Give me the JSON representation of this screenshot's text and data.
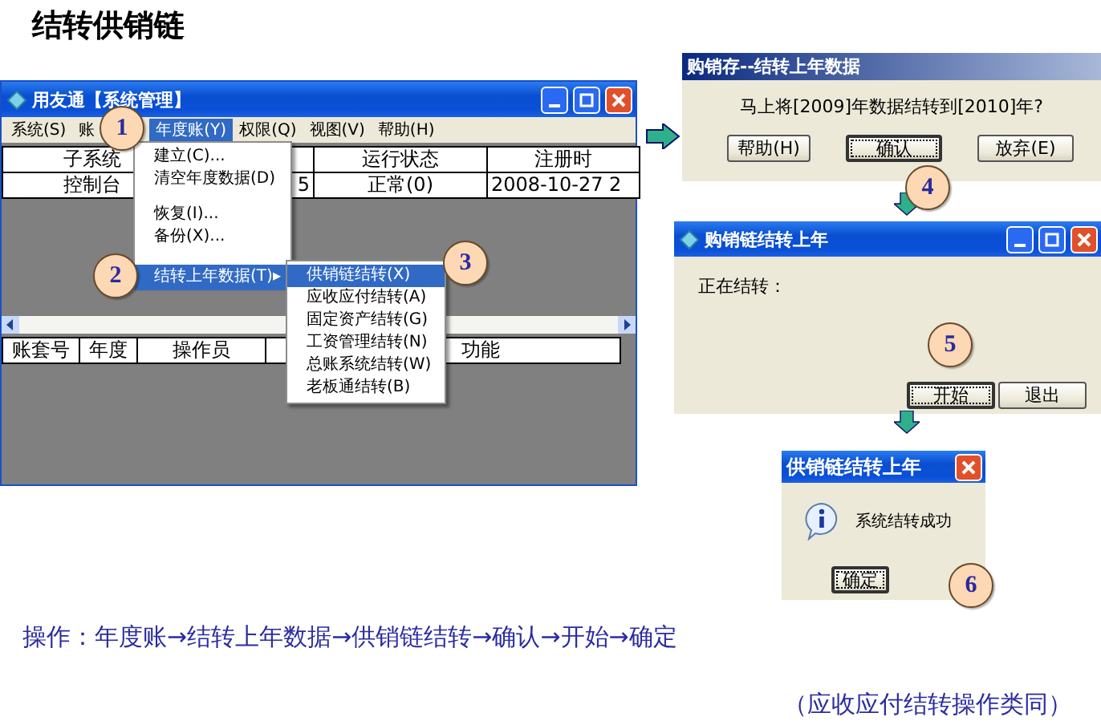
{
  "slide_title": "结转供销链",
  "main_window": {
    "title": "用友通【系统管理】",
    "menubar": [
      {
        "label": "系统(S)",
        "selected": false
      },
      {
        "label": "账",
        "selected": false
      },
      {
        "label": "年度账(Y)",
        "selected": true
      },
      {
        "label": "权限(Q)",
        "selected": false
      },
      {
        "label": "视图(V)",
        "selected": false
      },
      {
        "label": "帮助(H)",
        "selected": false
      }
    ],
    "table_1": {
      "columns": [
        {
          "header": "子系统"
        },
        {},
        {
          "header": "运行状态"
        },
        {
          "header": "注册时"
        }
      ],
      "rows": [
        [
          "控制台",
          "5",
          "正常(0)",
          "2008-10-27 2"
        ]
      ]
    },
    "table_2": {
      "columns": [
        {
          "header": "账套号"
        },
        {
          "header": "年度"
        },
        {
          "header": "操作员"
        },
        {},
        {
          "header": "功能"
        }
      ]
    }
  },
  "year_menu": [
    {
      "kind": "item",
      "label": "建立(C)...",
      "selected": false
    },
    {
      "kind": "item",
      "label": "清空年度数据(D)",
      "selected": false
    },
    {
      "kind": "separator"
    },
    {
      "kind": "item",
      "label": "恢复(I)...",
      "selected": false
    },
    {
      "kind": "item",
      "label": "备份(X)...",
      "selected": false
    },
    {
      "kind": "separator"
    },
    {
      "kind": "submenu",
      "label": "结转上年数据(T)",
      "arrow": "▸",
      "selected": true
    }
  ],
  "carry_menu": [
    {
      "label": "供销链结转(X)",
      "selected": true
    },
    {
      "label": "应收应付结转(A)",
      "selected": false
    },
    {
      "label": "固定资产结转(G)",
      "selected": false
    },
    {
      "label": "工资管理结转(N)",
      "selected": false
    },
    {
      "label": "总账系统结转(W)",
      "selected": false
    },
    {
      "label": "老板通结转(B)",
      "selected": false
    }
  ],
  "confirm_dialog": {
    "title": "购销存--结转上年数据",
    "message": "马上将[2009]年数据结转到[2010]年?",
    "buttons": [
      {
        "label": "帮助(H)",
        "focused": false
      },
      {
        "label": "确认",
        "focused": true
      },
      {
        "label": "放弃(E)",
        "focused": false
      }
    ]
  },
  "progress_window": {
    "title": "购销链结转上年",
    "status_label": "正在结转：",
    "buttons": [
      {
        "label": "开始",
        "focused": true
      },
      {
        "label": "退出",
        "focused": false
      }
    ]
  },
  "success_dialog": {
    "title": "供销链结转上年",
    "message": "系统结转成功",
    "buttons": [
      {
        "label": "确定",
        "focused": true
      }
    ]
  },
  "steps": [
    "1",
    "2",
    "3",
    "4",
    "5",
    "6"
  ],
  "instruction": "操作：年度账→结转上年数据→供销链结转→确认→开始→确定",
  "note": "（应收应付结转操作类同）"
}
